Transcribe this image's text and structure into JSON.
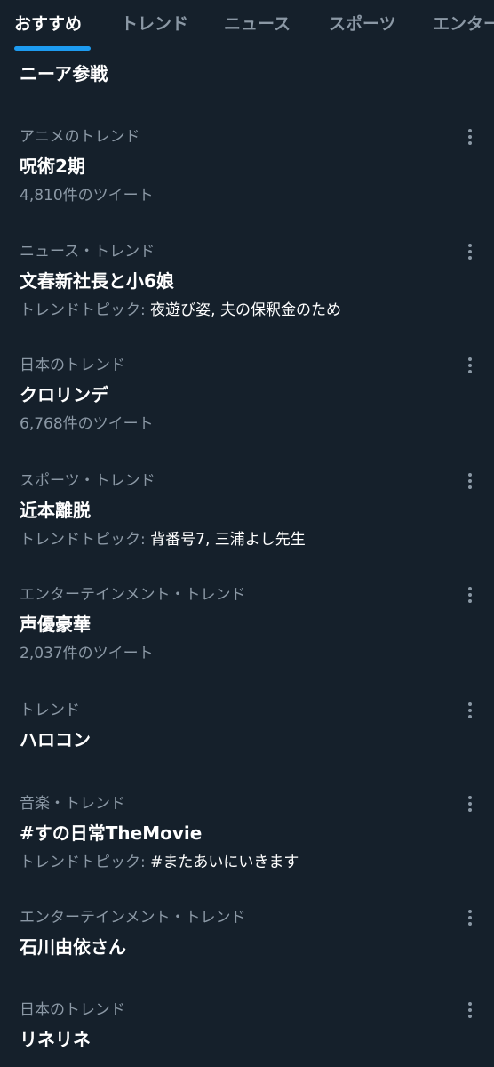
{
  "tabs": [
    {
      "label": "おすすめ",
      "active": true
    },
    {
      "label": "トレンド",
      "active": false
    },
    {
      "label": "ニュース",
      "active": false
    },
    {
      "label": "スポーツ",
      "active": false
    },
    {
      "label": "エンター",
      "active": false
    }
  ],
  "partial_trend": {
    "title": "ニーア参戦"
  },
  "trends": [
    {
      "category": "アニメのトレンド",
      "title": "呪術2期",
      "tweet_count": "4,810件のツイート"
    },
    {
      "category": "ニュース・トレンド",
      "title": "文春新社長と小6娘",
      "topic_prefix": "トレンドトピック:",
      "topics": "夜遊び姿, 夫の保釈金のため"
    },
    {
      "category": "日本のトレンド",
      "title": "クロリンデ",
      "tweet_count": "6,768件のツイート"
    },
    {
      "category": "スポーツ・トレンド",
      "title": "近本離脱",
      "topic_prefix": "トレンドトピック:",
      "topics": "背番号7, 三浦よし先生"
    },
    {
      "category": "エンターテインメント・トレンド",
      "title": "声優豪華",
      "tweet_count": "2,037件のツイート"
    },
    {
      "category": "トレンド",
      "title": "ハロコン"
    },
    {
      "category": "音楽・トレンド",
      "title": "#すの日常TheMovie",
      "topic_prefix": "トレンドトピック:",
      "topics": "#またあいにいきます"
    },
    {
      "category": "エンターテインメント・トレンド",
      "title": "石川由依さん"
    },
    {
      "category": "日本のトレンド",
      "title": "リネリネ"
    }
  ],
  "icons": {
    "more": "more-vertical-icon"
  },
  "colors": {
    "background": "#15202b",
    "text_primary": "#ffffff",
    "text_secondary": "#8b98a5",
    "accent": "#1d9bf0"
  }
}
